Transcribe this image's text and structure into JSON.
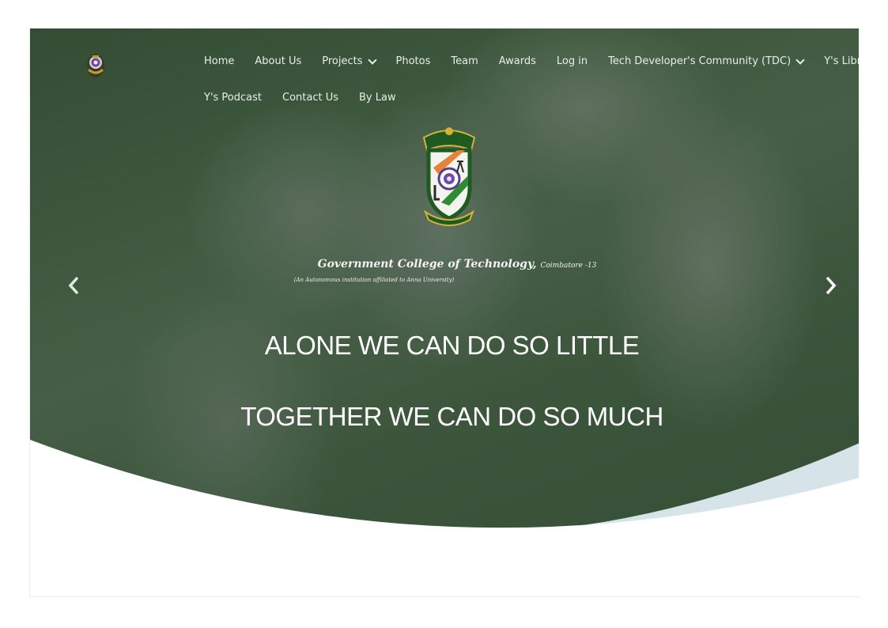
{
  "nav": {
    "logo_icon": "college-crest-icon",
    "row1": [
      {
        "label": "Home",
        "has_dropdown": false
      },
      {
        "label": "About Us",
        "has_dropdown": false
      },
      {
        "label": "Projects",
        "has_dropdown": true
      },
      {
        "label": "Photos",
        "has_dropdown": false
      },
      {
        "label": "Team",
        "has_dropdown": false
      },
      {
        "label": "Awards",
        "has_dropdown": false
      },
      {
        "label": "Log in",
        "has_dropdown": false
      },
      {
        "label": "Tech Developer's Community (TDC)",
        "has_dropdown": true
      },
      {
        "label": "Y's Library",
        "has_dropdown": false
      }
    ],
    "row2": [
      {
        "label": "Y's Podcast",
        "has_dropdown": false
      },
      {
        "label": "Contact Us",
        "has_dropdown": false
      },
      {
        "label": "By Law",
        "has_dropdown": false
      }
    ]
  },
  "hero": {
    "crest_icon": "college-crest-icon",
    "college_name": "Government College of Technology,",
    "college_city": "Coimbatore -13",
    "college_subtitle": "(An Autonomous institution affiliated to Anna University)",
    "headline_1": "ALONE WE CAN DO SO LITTLE",
    "headline_2": "TOGETHER WE CAN DO SO MUCH",
    "prev_icon": "chevron-left-icon",
    "next_icon": "chevron-right-icon"
  },
  "colors": {
    "nav_text": "#e9eee9",
    "headline_text": "#ffffff",
    "curve_fill": "#ffffff",
    "curve_accent": "#d6e4ea"
  }
}
